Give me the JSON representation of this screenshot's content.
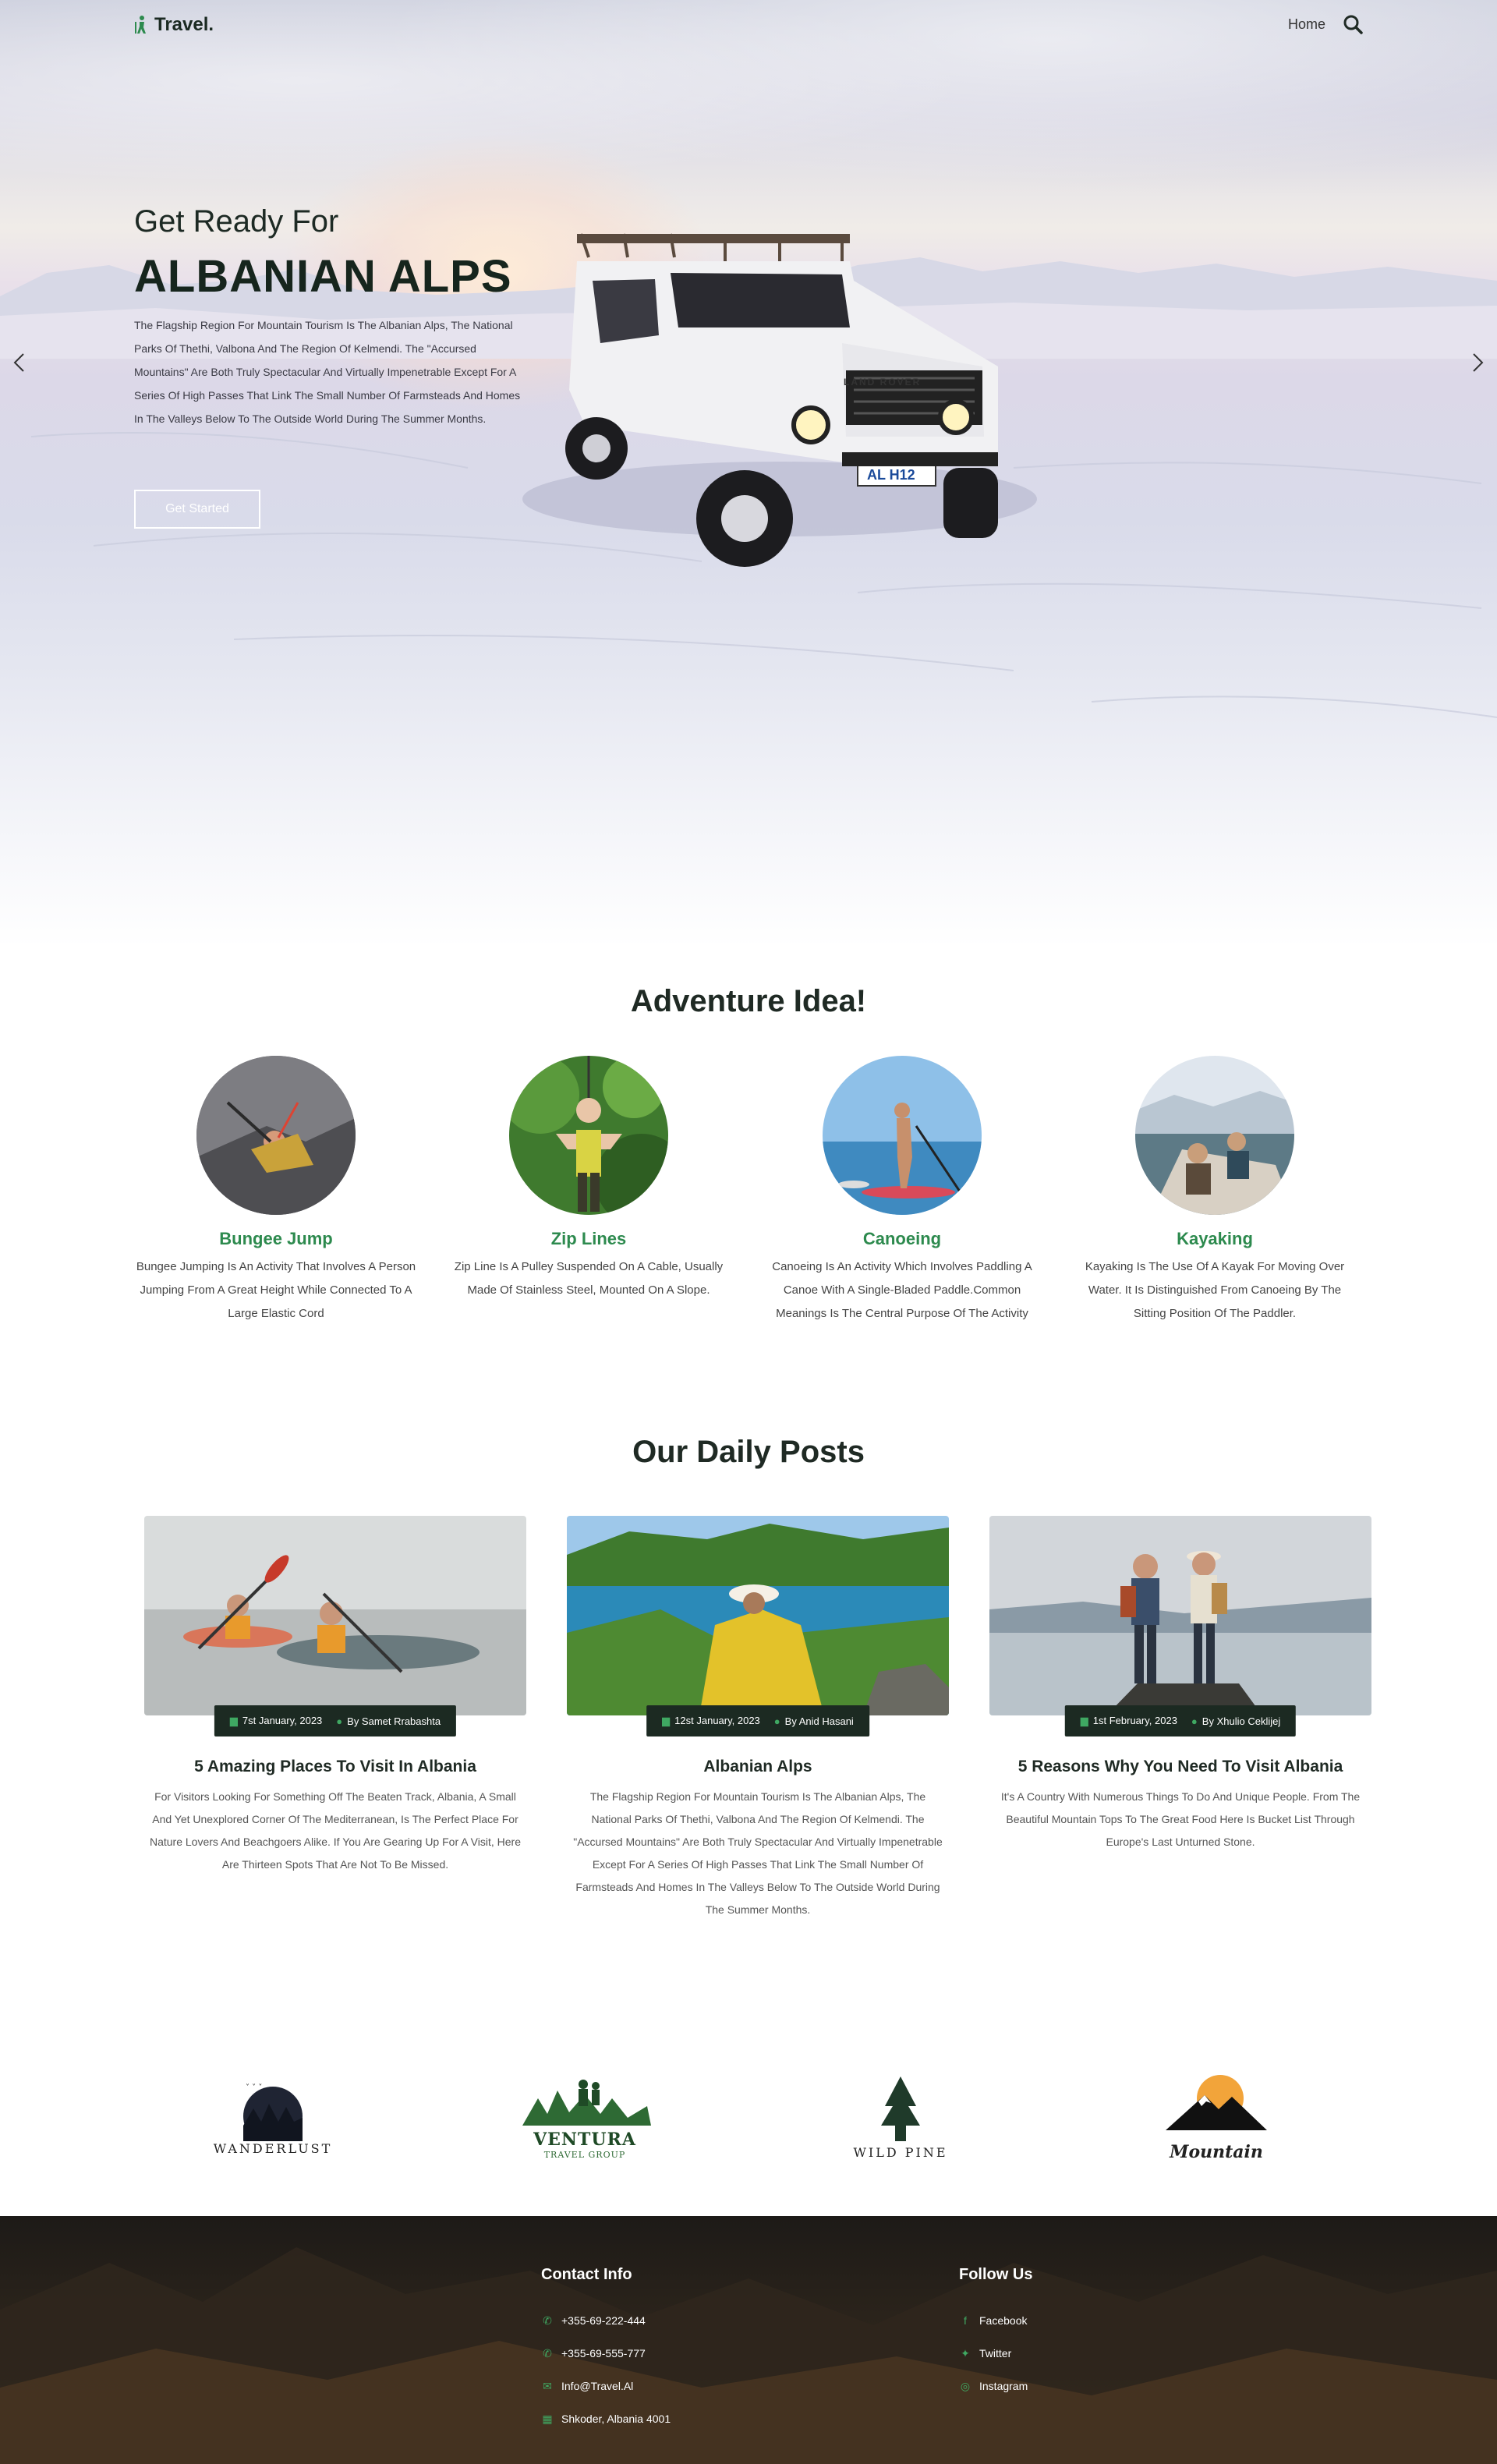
{
  "nav": {
    "brand": "Travel.",
    "links": [
      "Home"
    ]
  },
  "hero": {
    "kicker": "Get Ready For",
    "title": "ALBANIAN ALPS",
    "description": "The Flagship Region For Mountain Tourism Is The Albanian Alps, The National Parks Of Thethi, Valbona And The Region Of Kelmendi. The \"Accursed Mountains\" Are Both Truly Spectacular And Virtually Impenetrable Except For A Series Of High Passes That Link The Small Number Of Farmsteads And Homes In The Valleys Below To The Outside World During The Summer Months.",
    "button": "Get Started",
    "plate": "AL H12",
    "vehicle_brand": "LAND ROVER"
  },
  "adventure": {
    "title": "Adventure Idea!",
    "items": [
      {
        "name": "Bungee Jump",
        "text": "Bungee Jumping Is An Activity That Involves A Person Jumping From A Great Height While Connected To A Large Elastic Cord"
      },
      {
        "name": "Zip Lines",
        "text": "Zip Line Is A Pulley Suspended On A Cable, Usually Made Of Stainless Steel, Mounted On A Slope."
      },
      {
        "name": "Canoeing",
        "text": "Canoeing Is An Activity Which Involves Paddling A Canoe With A Single-Bladed Paddle.Common Meanings Is The Central Purpose Of The Activity"
      },
      {
        "name": "Kayaking",
        "text": "Kayaking Is The Use Of A Kayak For Moving Over Water. It Is Distinguished From Canoeing By The Sitting Position Of The Paddler."
      }
    ]
  },
  "posts": {
    "title": "Our Daily Posts",
    "items": [
      {
        "date": "7st January, 2023",
        "author": "By Samet Rrabashta",
        "title": "5 Amazing Places To Visit In Albania",
        "text": "For Visitors Looking For Something Off The Beaten Track, Albania, A Small And Yet Unexplored Corner Of The Mediterranean, Is The Perfect Place For Nature Lovers And Beachgoers Alike. If You Are Gearing Up For A Visit, Here Are Thirteen Spots That Are Not To Be Missed."
      },
      {
        "date": "12st January, 2023",
        "author": "By Anid Hasani",
        "title": "Albanian Alps",
        "text": "The Flagship Region For Mountain Tourism Is The Albanian Alps, The National Parks Of Thethi, Valbona And The Region Of Kelmendi. The \"Accursed Mountains\" Are Both Truly Spectacular And Virtually Impenetrable Except For A Series Of High Passes That Link The Small Number Of Farmsteads And Homes In The Valleys Below To The Outside World During The Summer Months."
      },
      {
        "date": "1st February, 2023",
        "author": "By Xhulio Ceklijej",
        "title": "5 Reasons Why You Need To Visit Albania",
        "text": "It's A Country With Numerous Things To Do And Unique People. From The Beautiful Mountain Tops To The Great Food Here Is Bucket List Through Europe's Last Unturned Stone."
      }
    ]
  },
  "partners": [
    "WANDERLUST",
    "VENTURA",
    "TRAVEL GROUP",
    "WILD PINE",
    "Mountain"
  ],
  "footer": {
    "contact_title": "Contact Info",
    "contacts": [
      "+355-69-222-444",
      "+355-69-555-777",
      "Info@Travel.Al",
      "Shkoder, Albania 4001"
    ],
    "follow_title": "Follow Us",
    "social": [
      "Facebook",
      "Twitter",
      "Instagram"
    ]
  },
  "colors": {
    "accent": "#2d8a4e",
    "dark": "#1c2a22",
    "footer": "#2a231b"
  }
}
